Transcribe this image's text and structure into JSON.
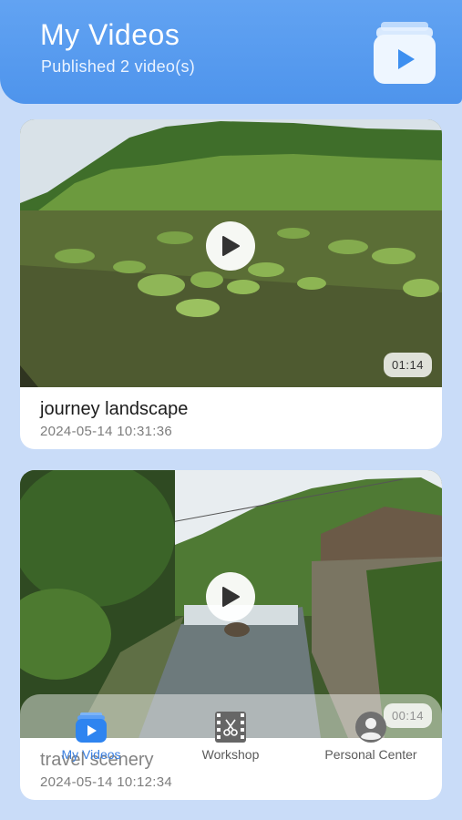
{
  "header": {
    "title": "My Videos",
    "subtitle": "Published 2 video(s)",
    "icon": "video-folder-icon"
  },
  "videos": [
    {
      "title": "journey landscape",
      "timestamp": "2024-05-14 10:31:36",
      "duration": "01:14"
    },
    {
      "title": "travel scenery",
      "timestamp": "2024-05-14 10:12:34",
      "duration": "00:14"
    }
  ],
  "tabs": [
    {
      "label": "My Videos",
      "icon": "video-folder-icon",
      "active": true
    },
    {
      "label": "Workshop",
      "icon": "film-scissors-icon",
      "active": false
    },
    {
      "label": "Personal Center",
      "icon": "user-avatar-icon",
      "active": false
    }
  ],
  "colors": {
    "accent": "#4e94ec",
    "background": "#c9dcf8",
    "active_tab": "#3a7fe0"
  }
}
